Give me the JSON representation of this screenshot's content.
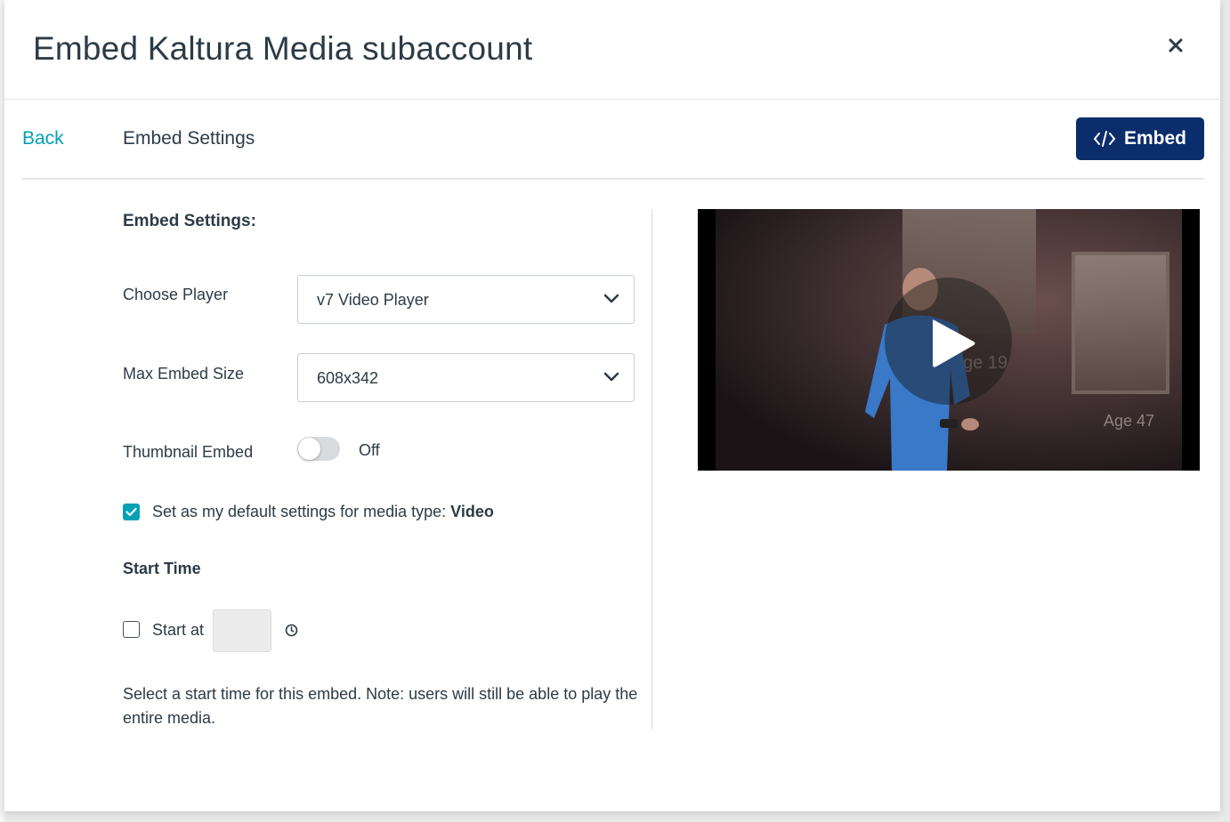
{
  "modal": {
    "title": "Embed Kaltura Media subaccount",
    "close_icon": "close-icon"
  },
  "subheader": {
    "back_label": "Back",
    "title": "Embed Settings",
    "embed_button_label": "Embed",
    "embed_icon": "code-icon"
  },
  "settings": {
    "heading": "Embed Settings:",
    "choose_player": {
      "label": "Choose Player",
      "value": "v7 Video Player"
    },
    "max_embed_size": {
      "label": "Max Embed Size",
      "value": "608x342"
    },
    "thumbnail_embed": {
      "label": "Thumbnail Embed",
      "state_text": "Off",
      "on": false
    },
    "default_settings": {
      "checked": true,
      "label_prefix": "Set as my default settings for media type: ",
      "media_type": "Video"
    },
    "start_time": {
      "heading": "Start Time",
      "checked": false,
      "start_at_label": "Start at",
      "value": "",
      "help_text": "Select a start time for this embed. Note: users will still be able to play the entire media."
    }
  },
  "preview": {
    "overlay_texts": [
      "ge 19",
      "Age 47"
    ],
    "play_icon": "play-icon"
  },
  "colors": {
    "accent": "#00a1b7",
    "embed_button_bg": "#0b2d6b",
    "text": "#2d3b45"
  }
}
